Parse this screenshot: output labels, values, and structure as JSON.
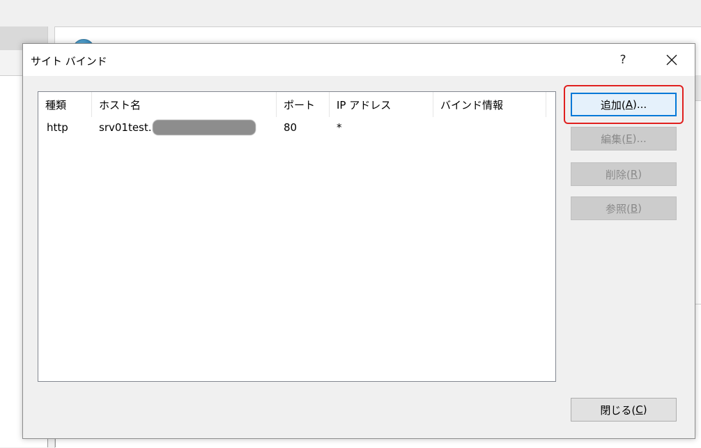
{
  "dialog": {
    "title": "サイト バインド",
    "help_label": "?"
  },
  "table": {
    "columns": [
      "種類",
      "ホスト名",
      "ポート",
      "IP アドレス",
      "バインド情報"
    ],
    "rows": [
      {
        "type": "http",
        "host_prefix": "srv01test.",
        "port": "80",
        "ip": "*",
        "binding_info": ""
      }
    ]
  },
  "buttons": {
    "add": {
      "label": "追加(",
      "mnemonic": "A",
      "suffix": ")..."
    },
    "edit": {
      "label": "編集(",
      "mnemonic": "E",
      "suffix": ")..."
    },
    "remove": {
      "label": "削除(",
      "mnemonic": "R",
      "suffix": ")"
    },
    "browse": {
      "label": "参照(",
      "mnemonic": "B",
      "suffix": ")"
    },
    "close": {
      "label": "閉じる(",
      "mnemonic": "C",
      "suffix": ")"
    }
  },
  "colors": {
    "highlight": "#e0201f",
    "primary_border": "#0078d7"
  },
  "icons": {
    "close": "close-icon",
    "site": "globe-icon"
  }
}
